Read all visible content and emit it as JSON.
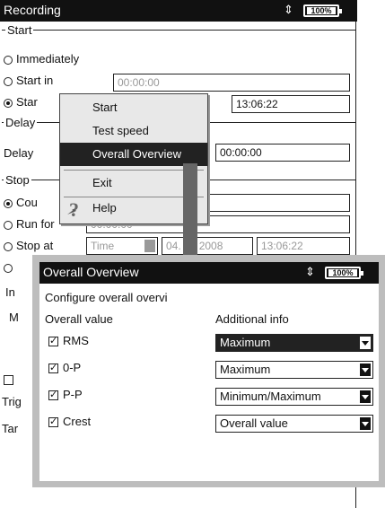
{
  "main": {
    "title": "Recording",
    "battery": "100%",
    "start_group": "Start",
    "immediately": "Immediately",
    "start_in": "Start in",
    "start_in_value": "00:00:00",
    "start_at_partial": "Star",
    "start_at_time": "13:06:22",
    "delay_group": "Delay",
    "delay_label": "Delay",
    "delay_value": "00:00:00",
    "stop_group": "Stop",
    "count_partial": "Cou",
    "runfor_partial": "Run for",
    "runfor_value": "00:00:00",
    "stop_at": "Stop at",
    "stop_at_mode": "Time",
    "stop_at_date_partial": "04.",
    "stop_at_date_year": "2008",
    "stop_at_time": "13:06:22",
    "in_partial": "In",
    "m_partial": "M",
    "trig_partial": "Trig",
    "tar_partial": "Tar"
  },
  "menu": {
    "start": "Start",
    "test_speed": "Test speed",
    "overall_overview": "Overall Overview",
    "exit": "Exit",
    "help": "Help"
  },
  "dialog": {
    "title": "Overall Overview",
    "battery": "100%",
    "description": "Configure overall overvi",
    "col_overall": "Overall value",
    "col_additional": "Additional info",
    "rows": [
      {
        "label": "RMS",
        "checked": true,
        "info": "Maximum"
      },
      {
        "label": "0-P",
        "checked": true,
        "info": "Maximum"
      },
      {
        "label": "P-P",
        "checked": true,
        "info": "Minimum/Maximum"
      },
      {
        "label": "Crest",
        "checked": true,
        "info": "Overall value"
      }
    ]
  }
}
